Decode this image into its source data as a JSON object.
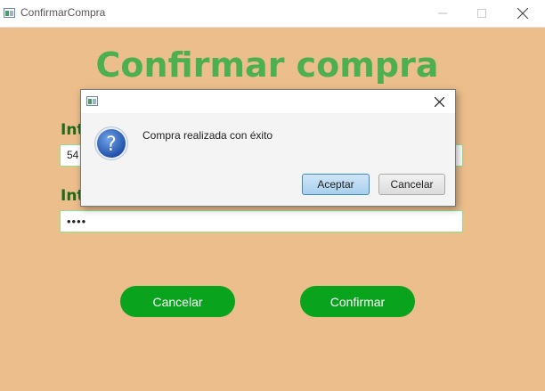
{
  "window": {
    "title": "ConfirmarCompra"
  },
  "form": {
    "heading": "Confirmar compra",
    "label1": "Int",
    "label2": "Int",
    "field1_value": "54",
    "field2_value": "••••",
    "cancel_label": "Cancelar",
    "confirm_label": "Confirmar"
  },
  "dialog": {
    "message": "Compra realizada con éxito",
    "ok_label": "Aceptar",
    "cancel_label": "Cancelar",
    "icon": "question-icon"
  },
  "colors": {
    "background": "#ecbe8c",
    "heading": "#4caf50",
    "button": "#0aa31e",
    "label": "#1e6b1e"
  }
}
